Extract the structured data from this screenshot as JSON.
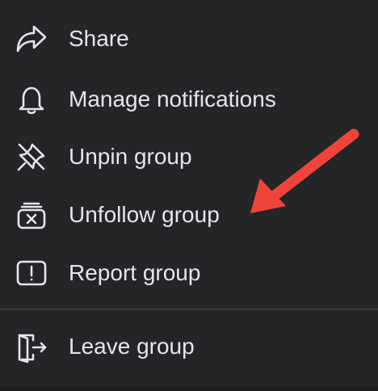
{
  "menu": {
    "items": [
      {
        "label": "Share",
        "icon": "share-icon"
      },
      {
        "label": "Manage notifications",
        "icon": "bell-icon"
      },
      {
        "label": "Unpin group",
        "icon": "unpin-icon"
      },
      {
        "label": "Unfollow group",
        "icon": "unfollow-icon"
      },
      {
        "label": "Report group",
        "icon": "report-icon"
      },
      {
        "label": "Leave group",
        "icon": "leave-icon"
      }
    ]
  },
  "colors": {
    "background": "#242526",
    "text": "#e4e6eb",
    "divider": "#3a3b3c",
    "annotation_arrow": "#f0443a"
  }
}
